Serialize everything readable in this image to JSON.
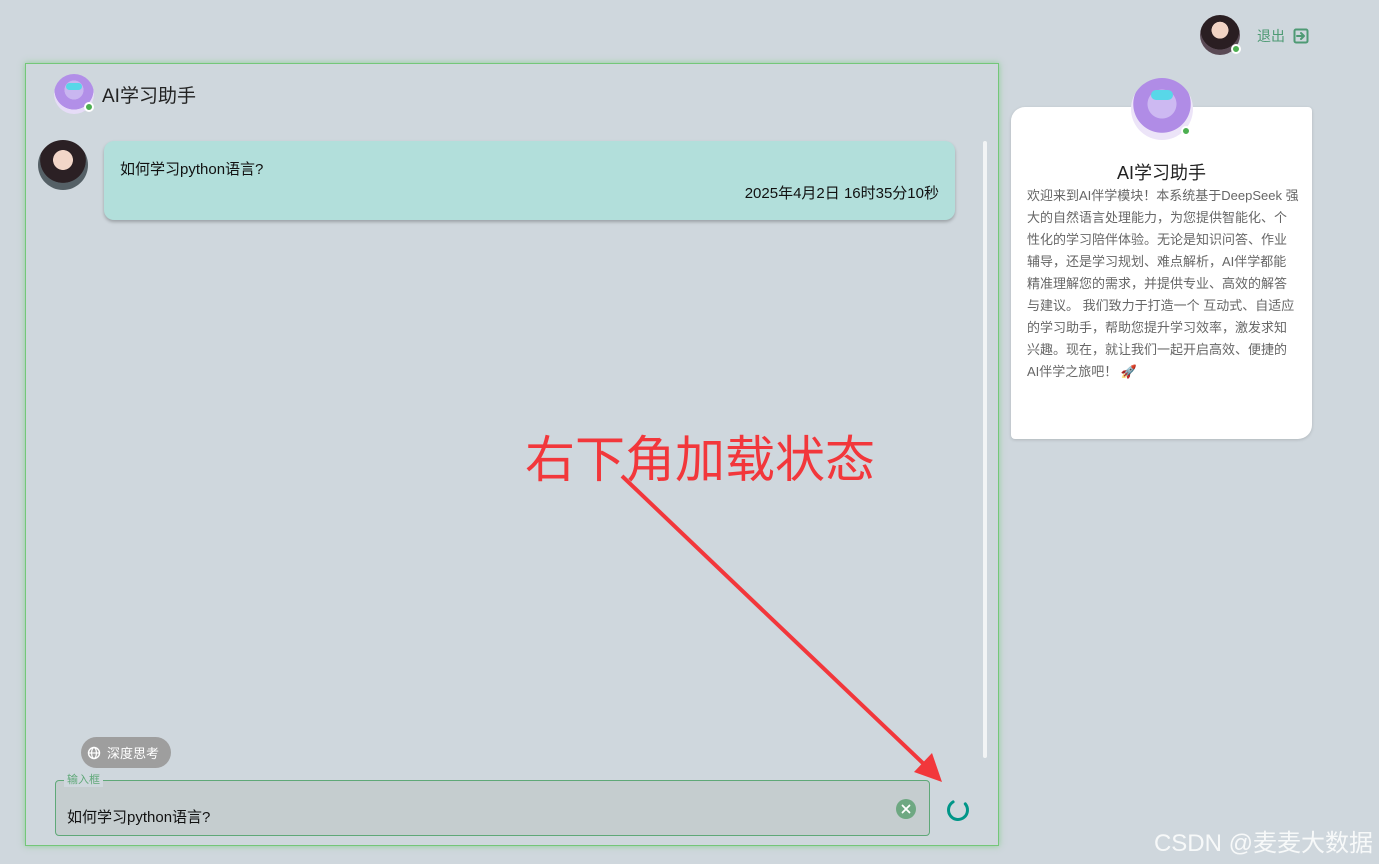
{
  "topbar": {
    "logout_label": "退出"
  },
  "chat": {
    "title": "AI学习助手",
    "message": {
      "text": "如何学习python语言?",
      "time": "2025年4月2日 16时35分10秒"
    },
    "deep_think_label": "深度思考",
    "input": {
      "label": "输入框",
      "value": "如何学习python语言?"
    }
  },
  "info": {
    "title": "AI学习助手",
    "description": "欢迎来到AI伴学模块！本系统基于DeepSeek 强大的自然语言处理能力，为您提供智能化、个性化的学习陪伴体验。无论是知识问答、作业辅导，还是学习规划、难点解析，AI伴学都能精准理解您的需求，并提供专业、高效的解答与建议。 我们致力于打造一个 互动式、自适应 的学习助手，帮助您提升学习效率，激发求知兴趣。现在，就让我们一起开启高效、便捷的AI伴学之旅吧！ 🚀"
  },
  "annotation": {
    "text": "右下角加载状态"
  },
  "watermark": "CSDN @麦麦大数据",
  "colors": {
    "accent_green": "#4e9a74",
    "bubble": "#b2dfdb",
    "annotation_red": "#f2373b",
    "spinner": "#009688"
  }
}
